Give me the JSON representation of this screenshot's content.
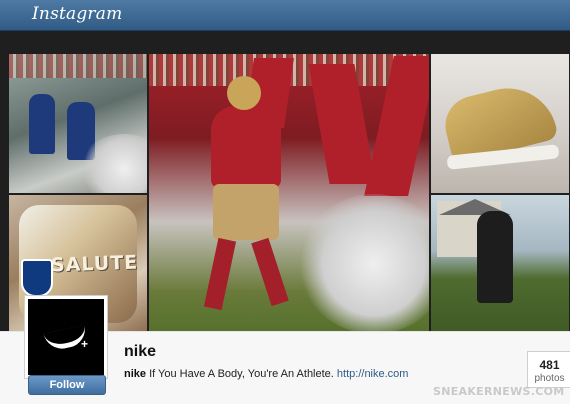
{
  "app": {
    "title": "Instagram"
  },
  "tiles": [
    {
      "name": "giants-players-tile"
    },
    {
      "name": "salute-gloves-tile",
      "overlay_text": "SALUTE"
    },
    {
      "name": "49ers-player-tile"
    },
    {
      "name": "sneaker-tile"
    },
    {
      "name": "runner-tile"
    }
  ],
  "profile": {
    "username": "nike",
    "bio_name": "nike",
    "bio_text": "If You Have A Body, You're An Athlete.",
    "bio_link": "http://nike.com",
    "follow_label": "Follow",
    "photos_count": "481",
    "photos_label": "photos"
  },
  "watermark": "SNEAKERNEWS.COM",
  "colors": {
    "header": "#3f6b96",
    "follow_button": "#4f7fb2",
    "link": "#2f5b86"
  }
}
